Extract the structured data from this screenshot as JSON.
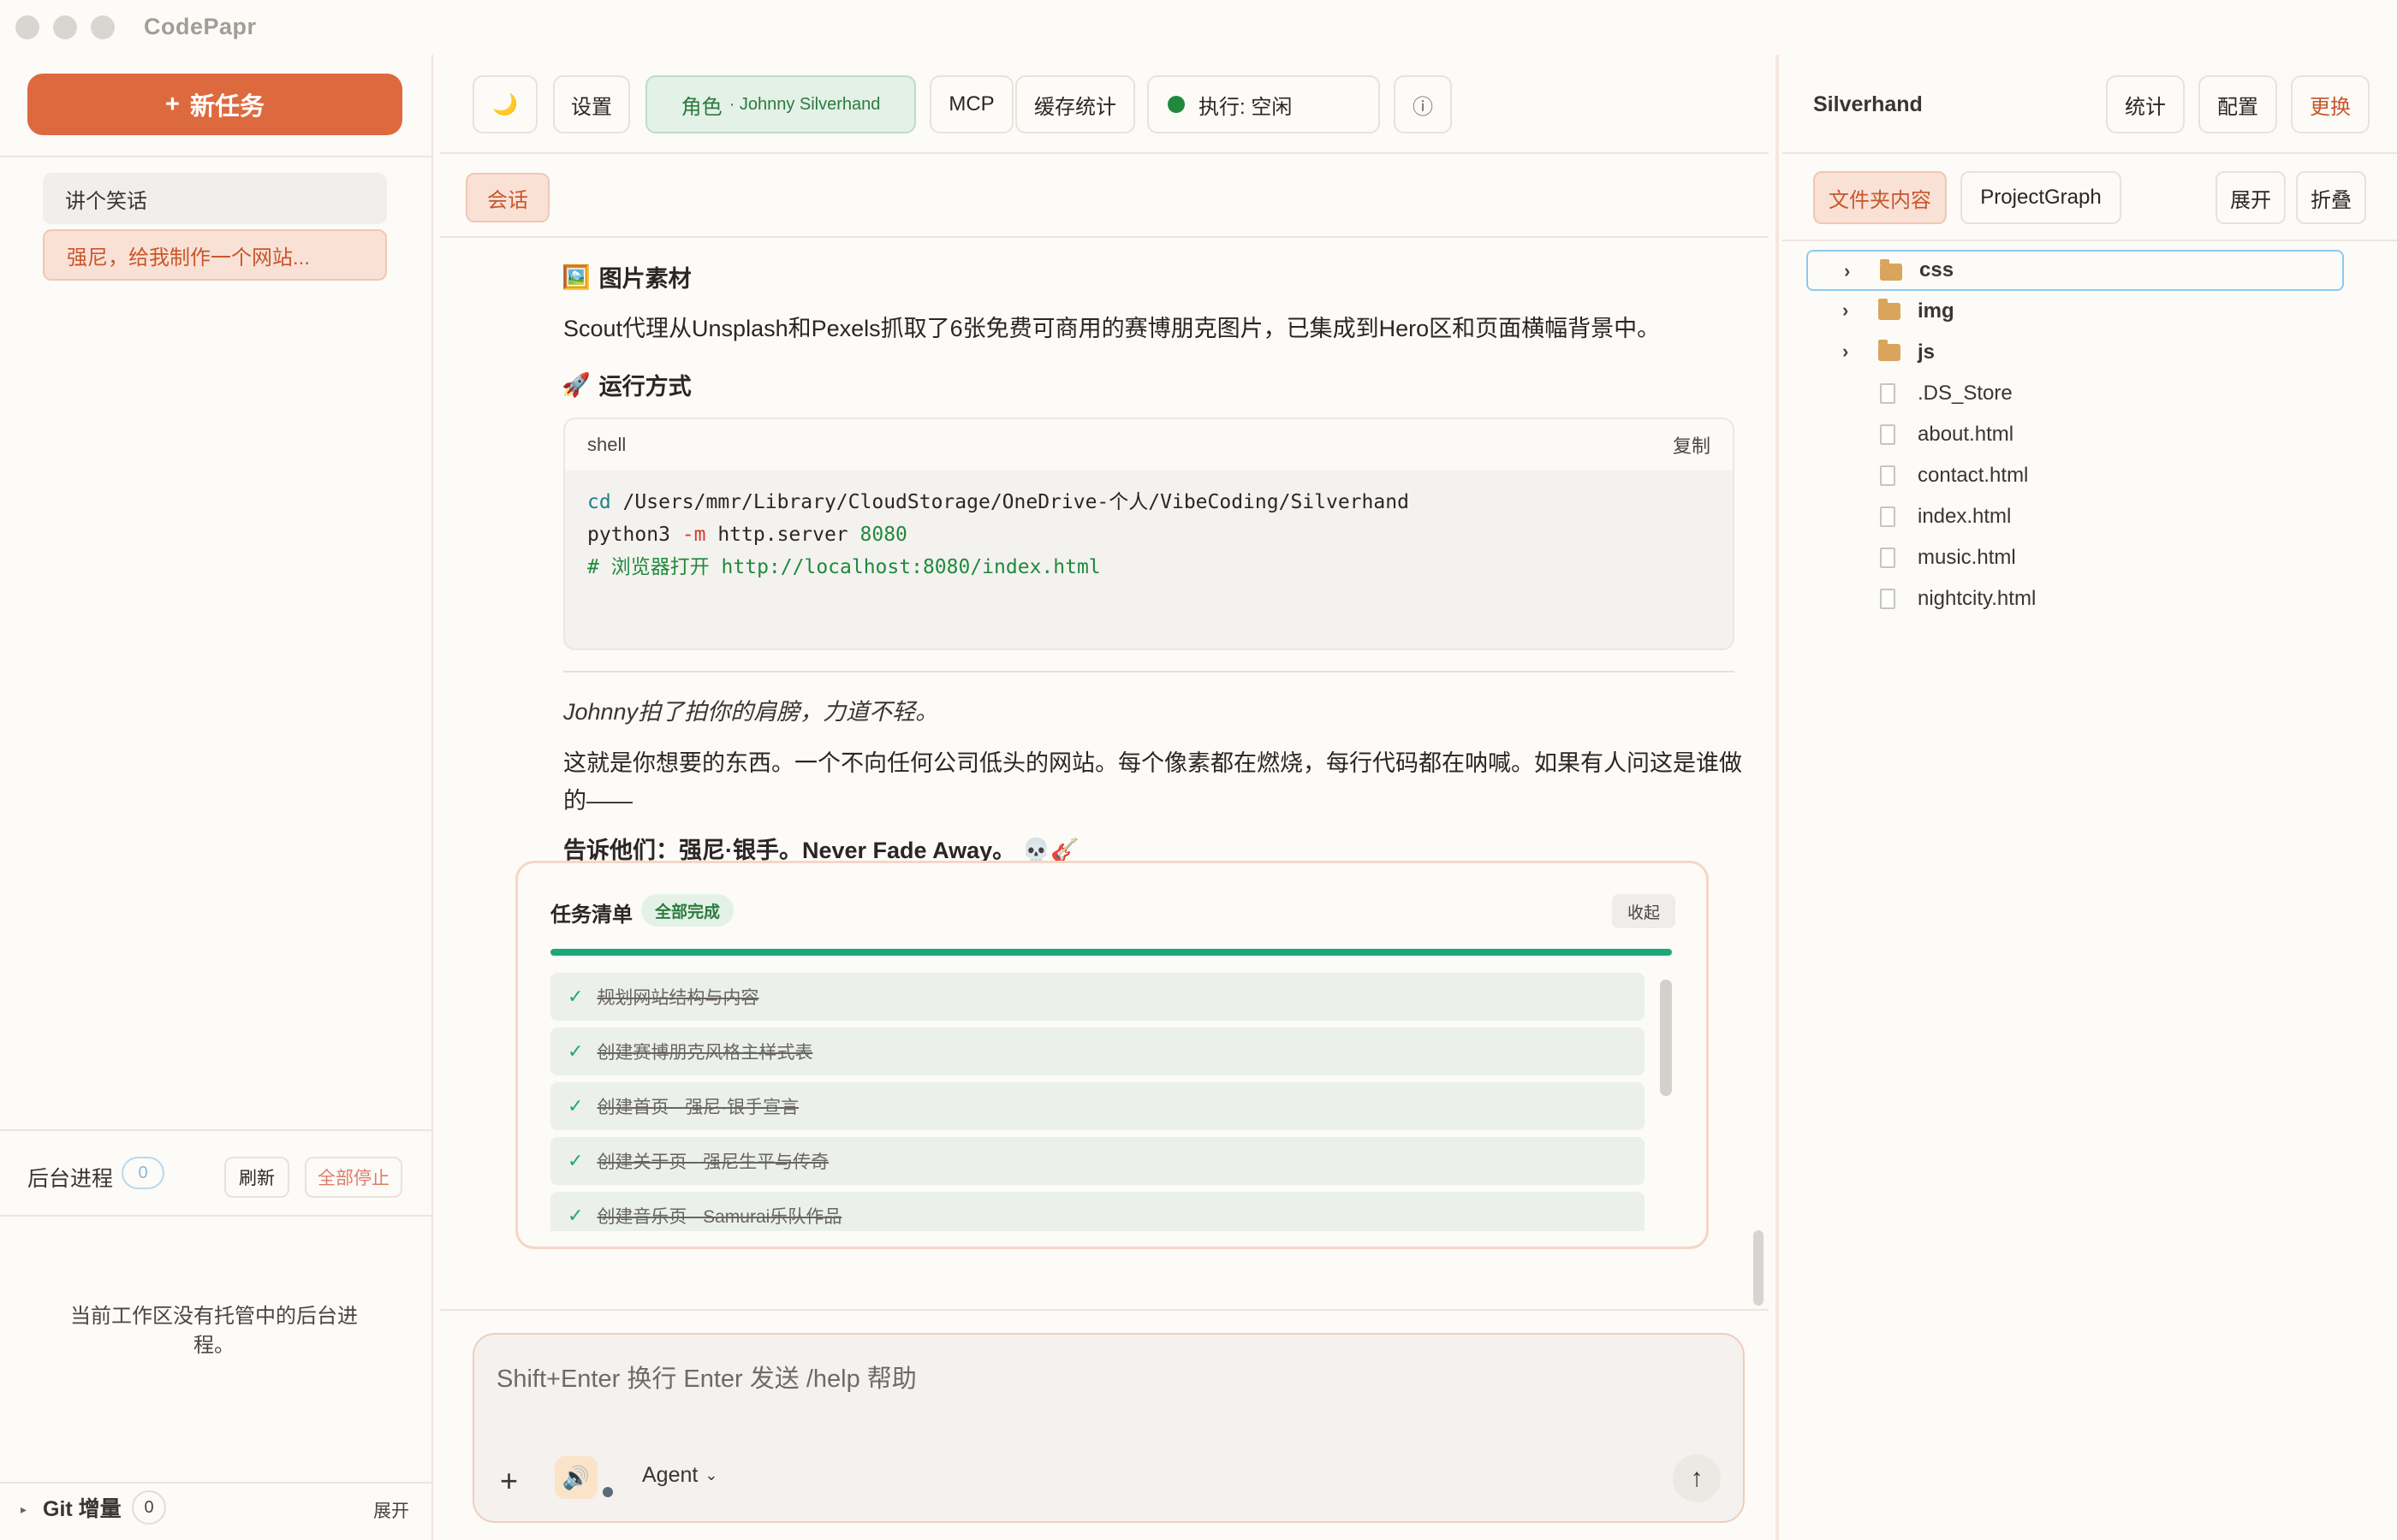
{
  "app": {
    "title": "CodePapr"
  },
  "sidebar": {
    "new_task": "新任务",
    "tasks": [
      {
        "label": "讲个笑话"
      },
      {
        "label": "强尼，给我制作一个网站..."
      }
    ],
    "background": {
      "title": "后台进程",
      "count": "0",
      "refresh": "刷新",
      "stop_all": "全部停止",
      "empty": "当前工作区没有托管中的后台进程。"
    },
    "git": {
      "title": "Git 增量",
      "count": "0",
      "expand": "展开"
    }
  },
  "toolbar": {
    "theme_icon": "moon-icon",
    "settings": "设置",
    "role_label": "角色",
    "role_name": "· Johnny Silverhand",
    "mcp": "MCP",
    "cache_stats": "缓存统计",
    "exec_status": "执行: 空闲",
    "info_icon": "info-icon",
    "status_color": "#1f8a3c"
  },
  "tabs": {
    "session": "会话"
  },
  "message": {
    "images_heading": "图片素材",
    "images_text": "Scout代理从Unsplash和Pexels抓取了6张免费可商用的赛博朋克图片，已集成到Hero区和页面横幅背景中。",
    "run_heading": "运行方式",
    "code": {
      "lang": "shell",
      "copy": "复制",
      "line1_cmd": "cd",
      "line1_path": " /Users/mmr/Library/CloudStorage/OneDrive-个人/VibeCoding/Silverhand",
      "line2_prog": "python3 ",
      "line2_flag": "-m",
      "line2_mod": " http.server ",
      "line2_port": "8080",
      "line3_comment": "# 浏览器打开 http://localhost:8080/index.html"
    },
    "italic": "Johnny拍了拍你的肩膀，力道不轻。",
    "para1": "这就是你想要的东西。一个不向任何公司低头的网站。每个像素都在燃烧，每行代码都在呐喊。如果有人问这是谁做的——",
    "para2": "告诉他们：强尼·银手。Never Fade Away。 💀🎸"
  },
  "task_list": {
    "title": "任务清单",
    "badge": "全部完成",
    "collapse": "收起",
    "progress": 1.0,
    "items": [
      "规划网站结构与内容",
      "创建赛博朋克风格主样式表",
      "创建首页 - 强尼·银手宣言",
      "创建关于页 - 强尼生平与传奇",
      "创建音乐页 - Samurai乐队作品"
    ]
  },
  "input": {
    "placeholder": "Shift+Enter 换行 Enter 发送 /help 帮助",
    "agent": "Agent"
  },
  "right_panel": {
    "title": "Silverhand",
    "stats": "统计",
    "config": "配置",
    "replace": "更换",
    "tab_files": "文件夹内容",
    "tab_graph": "ProjectGraph",
    "expand": "展开",
    "collapse": "折叠",
    "tree": [
      {
        "name": "css",
        "type": "folder"
      },
      {
        "name": "img",
        "type": "folder"
      },
      {
        "name": "js",
        "type": "folder"
      },
      {
        "name": ".DS_Store",
        "type": "file"
      },
      {
        "name": "about.html",
        "type": "file"
      },
      {
        "name": "contact.html",
        "type": "file"
      },
      {
        "name": "index.html",
        "type": "file"
      },
      {
        "name": "music.html",
        "type": "file"
      },
      {
        "name": "nightcity.html",
        "type": "file"
      }
    ]
  }
}
